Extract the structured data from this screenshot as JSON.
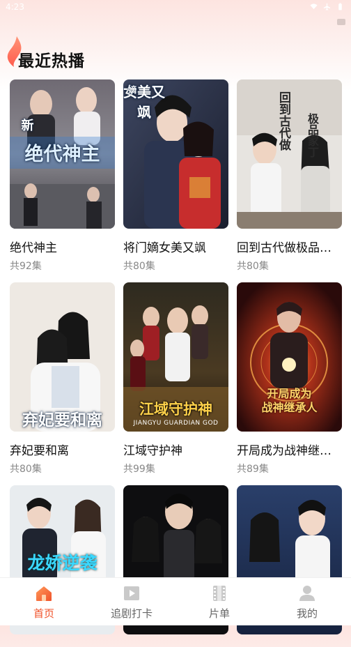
{
  "status_bar": {
    "time": "4:23"
  },
  "section": {
    "title": "最近热播",
    "icon": "flame-icon"
  },
  "dramas": [
    {
      "title": "绝代神主",
      "episodes": "共92集",
      "poster_text": "绝代神主",
      "poster_small": "新"
    },
    {
      "title": "将门嫡女美又飒",
      "episodes": "共80集",
      "poster_text": "女美又飒",
      "poster_small": "嫡"
    },
    {
      "title": "回到古代做极品家丁",
      "episodes": "共80集",
      "poster_text": "回到古代做",
      "poster_small": "极品家丁"
    },
    {
      "title": "弃妃要和离",
      "episodes": "共80集",
      "poster_text": "弃妃要和离",
      "poster_small": ""
    },
    {
      "title": "江域守护神",
      "episodes": "共99集",
      "poster_text": "江域守护神",
      "poster_small": "JIANGYU GUARDIAN GOD"
    },
    {
      "title": "开局成为战神继承人",
      "episodes": "共89集",
      "poster_text": "开局成为",
      "poster_small": "战神继承人"
    },
    {
      "title": "",
      "episodes": "",
      "poster_text": "龙娇逆袭",
      "poster_small": ""
    },
    {
      "title": "",
      "episodes": "",
      "poster_text": "",
      "poster_small": ""
    },
    {
      "title": "",
      "episodes": "",
      "poster_text": "",
      "poster_small": ""
    }
  ],
  "tabs": [
    {
      "label": "首页",
      "icon": "home-icon",
      "active": true
    },
    {
      "label": "追剧打卡",
      "icon": "play-icon",
      "active": false
    },
    {
      "label": "片单",
      "icon": "film-icon",
      "active": false
    },
    {
      "label": "我的",
      "icon": "user-icon",
      "active": false
    }
  ],
  "colors": {
    "accent": "#f0522a",
    "inactive": "#666666",
    "subtext": "#888888"
  }
}
